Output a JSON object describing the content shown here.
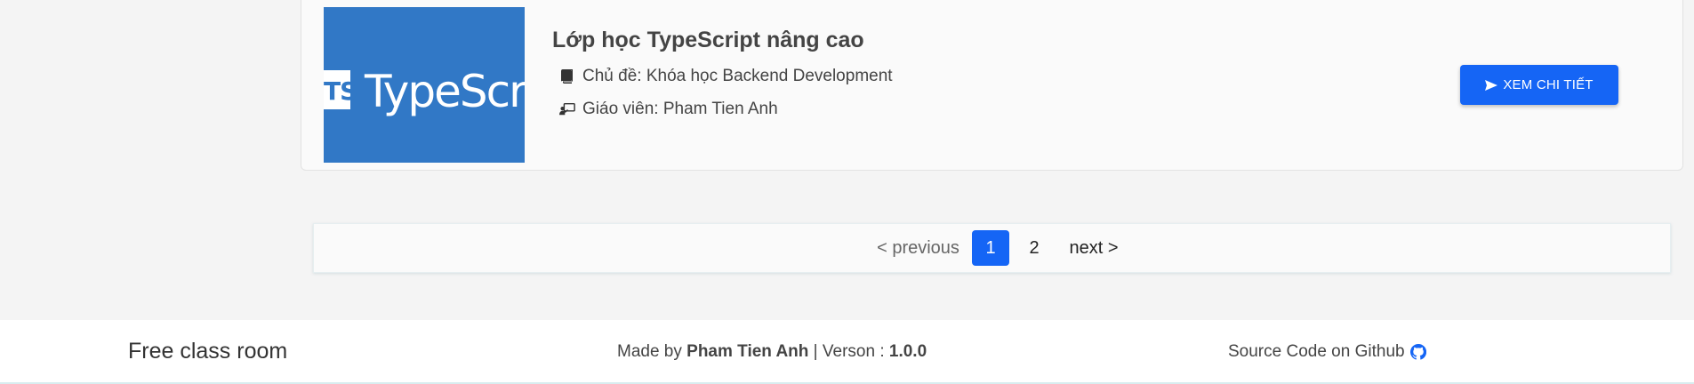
{
  "course": {
    "thumbnail_badge": "TS",
    "thumbnail_word": "TypeScript",
    "title": "Lớp học TypeScript nâng cao",
    "topic": "Chủ đề: Khóa học Backend Development",
    "teacher": "Giáo viên: Pham Tien Anh",
    "detail_button": "XEM CHI TIẾT",
    "icons": {
      "topic": "book-icon",
      "teacher": "chalkboard-teacher-icon",
      "button": "send-icon"
    }
  },
  "pagination": {
    "previous": "< previous",
    "pages": [
      "1",
      "2"
    ],
    "current": "1",
    "next": "next >"
  },
  "footer": {
    "brand": "Free class room",
    "made_by_prefix": "Made by ",
    "author": "Pham Tien Anh",
    "version_prefix": " | Verson : ",
    "version": "1.0.0",
    "source": "Source Code on Github",
    "source_icon": "github-icon"
  },
  "colors": {
    "primary": "#1565f5",
    "typescript": "#3178c6"
  }
}
